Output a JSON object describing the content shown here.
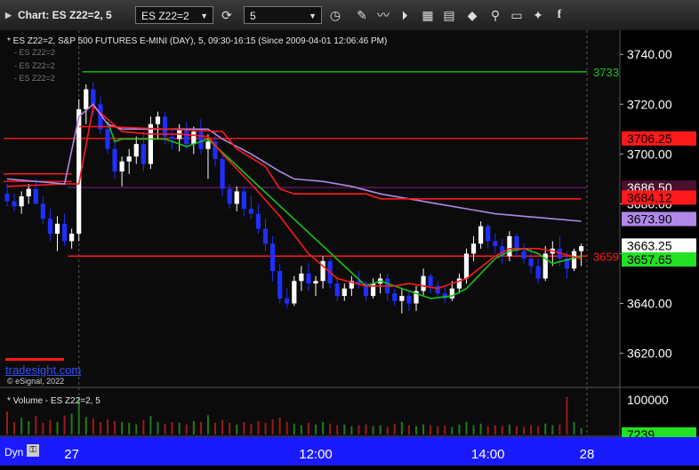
{
  "titlebar": {
    "title": "Chart: ES Z22=2, 5",
    "symbol": "ES Z22=2",
    "interval": "5"
  },
  "chart_header": "* ES Z22=2, S&P 500 FUTURES E-MINI (DAY), 5, 09:30-16:15 (Since 2009-04-01 12:06:46 PM)",
  "legend_items": [
    "- ES Z22=2",
    "- ES Z22=2",
    "- ES Z22=2"
  ],
  "watermark": "tradesight.com",
  "copyright": "© eSignal, 2022",
  "volume_header": "* Volume - ES Z22=2, 5",
  "bottom_bar": {
    "dyn_label": "Dyn"
  },
  "colors": {
    "up": "#ffffff",
    "down": "#1f2fff",
    "red": "#ff1a1a",
    "green": "#16c416",
    "purple": "#b088e8",
    "maroon": "#8b1a8b"
  },
  "chart_data": {
    "type": "candlestick",
    "price_axis": {
      "ylim": [
        3607,
        3749
      ],
      "ticks": [
        3620,
        3640,
        3660,
        3680,
        3700,
        3720,
        3740
      ]
    },
    "x_axis": {
      "tick_labels": [
        "27",
        "12:00",
        "14:00",
        "28"
      ],
      "tick_bars": [
        11,
        43,
        67,
        95
      ]
    },
    "bars": [
      [
        3684,
        3688,
        3679,
        3681
      ],
      [
        3681,
        3684,
        3677,
        3679
      ],
      [
        3679,
        3685,
        3676,
        3683
      ],
      [
        3683,
        3688,
        3680,
        3686
      ],
      [
        3686,
        3690,
        3682,
        3680
      ],
      [
        3680,
        3683,
        3672,
        3674
      ],
      [
        3674,
        3678,
        3665,
        3668
      ],
      [
        3668,
        3675,
        3661,
        3672
      ],
      [
        3672,
        3676,
        3663,
        3665
      ],
      [
        3665,
        3670,
        3662,
        3668
      ],
      [
        3668,
        3722,
        3665,
        3718
      ],
      [
        3718,
        3728,
        3712,
        3726
      ],
      [
        3726,
        3729,
        3715,
        3720
      ],
      [
        3720,
        3723,
        3708,
        3710
      ],
      [
        3710,
        3712,
        3700,
        3702
      ],
      [
        3702,
        3705,
        3690,
        3693
      ],
      [
        3693,
        3699,
        3687,
        3697
      ],
      [
        3697,
        3702,
        3692,
        3699
      ],
      [
        3699,
        3707,
        3696,
        3704
      ],
      [
        3704,
        3709,
        3693,
        3696
      ],
      [
        3696,
        3715,
        3694,
        3712
      ],
      [
        3712,
        3717,
        3706,
        3715
      ],
      [
        3715,
        3717,
        3704,
        3707
      ],
      [
        3707,
        3710,
        3702,
        3706
      ],
      [
        3706,
        3712,
        3701,
        3710
      ],
      [
        3710,
        3713,
        3702,
        3704
      ],
      [
        3704,
        3711,
        3700,
        3709
      ],
      [
        3709,
        3714,
        3700,
        3702
      ],
      [
        3702,
        3708,
        3690,
        3705
      ],
      [
        3705,
        3709,
        3695,
        3698
      ],
      [
        3698,
        3700,
        3683,
        3686
      ],
      [
        3686,
        3688,
        3678,
        3680
      ],
      [
        3680,
        3687,
        3677,
        3685
      ],
      [
        3685,
        3687,
        3675,
        3678
      ],
      [
        3678,
        3683,
        3674,
        3676
      ],
      [
        3676,
        3680,
        3668,
        3670
      ],
      [
        3670,
        3674,
        3661,
        3664
      ],
      [
        3664,
        3667,
        3649,
        3653
      ],
      [
        3653,
        3656,
        3640,
        3642
      ],
      [
        3642,
        3646,
        3638,
        3640
      ],
      [
        3640,
        3651,
        3639,
        3649
      ],
      [
        3649,
        3655,
        3645,
        3652
      ],
      [
        3652,
        3656,
        3645,
        3648
      ],
      [
        3648,
        3651,
        3643,
        3649
      ],
      [
        3649,
        3659,
        3646,
        3657
      ],
      [
        3657,
        3658,
        3646,
        3648
      ],
      [
        3648,
        3651,
        3641,
        3643
      ],
      [
        3643,
        3648,
        3641,
        3646
      ],
      [
        3646,
        3651,
        3643,
        3649
      ],
      [
        3649,
        3653,
        3646,
        3648
      ],
      [
        3648,
        3649,
        3641,
        3643
      ],
      [
        3643,
        3650,
        3642,
        3648
      ],
      [
        3648,
        3652,
        3644,
        3650
      ],
      [
        3650,
        3652,
        3641,
        3644
      ],
      [
        3644,
        3646,
        3639,
        3641
      ],
      [
        3641,
        3646,
        3636,
        3643
      ],
      [
        3643,
        3645,
        3637,
        3640
      ],
      [
        3640,
        3647,
        3637,
        3645
      ],
      [
        3645,
        3654,
        3643,
        3651
      ],
      [
        3651,
        3652,
        3644,
        3647
      ],
      [
        3647,
        3649,
        3642,
        3644
      ],
      [
        3644,
        3647,
        3640,
        3642
      ],
      [
        3642,
        3649,
        3641,
        3646
      ],
      [
        3646,
        3652,
        3644,
        3650
      ],
      [
        3650,
        3662,
        3648,
        3660
      ],
      [
        3660,
        3667,
        3657,
        3664
      ],
      [
        3664,
        3673,
        3662,
        3671
      ],
      [
        3671,
        3672,
        3662,
        3665
      ],
      [
        3665,
        3668,
        3660,
        3663
      ],
      [
        3663,
        3666,
        3656,
        3659
      ],
      [
        3659,
        3669,
        3657,
        3667
      ],
      [
        3667,
        3668,
        3659,
        3661
      ],
      [
        3661,
        3664,
        3656,
        3658
      ],
      [
        3658,
        3662,
        3652,
        3655
      ],
      [
        3655,
        3658,
        3648,
        3650
      ],
      [
        3650,
        3663,
        3649,
        3660
      ],
      [
        3660,
        3665,
        3655,
        3662
      ],
      [
        3662,
        3667,
        3655,
        3658
      ],
      [
        3658,
        3661,
        3650,
        3654
      ],
      [
        3654,
        3662,
        3653,
        3661
      ],
      [
        3661,
        3664,
        3655,
        3663
      ]
    ],
    "volume": [
      0.55,
      0.3,
      0.4,
      0.32,
      0.45,
      0.28,
      0.35,
      0.3,
      0.45,
      0.5,
      0.9,
      0.42,
      0.38,
      0.3,
      0.36,
      0.32,
      0.3,
      0.28,
      0.24,
      0.34,
      0.44,
      0.3,
      0.26,
      0.3,
      0.28,
      0.24,
      0.32,
      0.3,
      0.46,
      0.28,
      0.34,
      0.28,
      0.24,
      0.3,
      0.26,
      0.32,
      0.28,
      0.36,
      0.4,
      0.3,
      0.26,
      0.22,
      0.28,
      0.24,
      0.3,
      0.26,
      0.22,
      0.24,
      0.2,
      0.22,
      0.24,
      0.2,
      0.22,
      0.18,
      0.26,
      0.3,
      0.22,
      0.2,
      0.24,
      0.22,
      0.2,
      0.22,
      0.18,
      0.24,
      0.3,
      0.22,
      0.26,
      0.2,
      0.22,
      0.2,
      0.24,
      0.2,
      0.18,
      0.22,
      0.2,
      0.26,
      0.22,
      0.24,
      0.9,
      0.3,
      0.15
    ],
    "volume_axis": {
      "ticks": [
        "100000"
      ]
    },
    "lines": [
      {
        "color": "green",
        "points": [
          [
            14,
            3713
          ],
          [
            15,
            3705
          ],
          [
            16,
            3706
          ],
          [
            17,
            3706
          ],
          [
            18,
            3706
          ],
          [
            19,
            3706
          ],
          [
            20,
            3706
          ],
          [
            21,
            3706
          ],
          [
            22,
            3706
          ],
          [
            25,
            3703
          ],
          [
            28,
            3706
          ],
          [
            50,
            3647
          ],
          [
            52,
            3649
          ],
          [
            58,
            3643
          ],
          [
            59,
            3642
          ],
          [
            62,
            3643
          ],
          [
            64,
            3646
          ],
          [
            66,
            3652
          ],
          [
            68,
            3658
          ],
          [
            70,
            3661
          ],
          [
            72,
            3662
          ],
          [
            74,
            3660
          ],
          [
            76,
            3656
          ],
          [
            80,
            3659
          ]
        ]
      },
      {
        "color": "red",
        "points": [
          [
            0,
            3687
          ],
          [
            8,
            3688
          ],
          [
            10,
            3688
          ],
          [
            12,
            3719
          ],
          [
            14,
            3714
          ],
          [
            16,
            3709
          ],
          [
            20,
            3708
          ],
          [
            24,
            3708
          ],
          [
            28,
            3707
          ],
          [
            30,
            3700
          ],
          [
            34,
            3688
          ],
          [
            38,
            3675
          ],
          [
            42,
            3660
          ],
          [
            46,
            3650
          ],
          [
            50,
            3647
          ],
          [
            54,
            3647
          ],
          [
            56,
            3648
          ],
          [
            60,
            3646
          ],
          [
            64,
            3650
          ],
          [
            68,
            3659
          ],
          [
            70,
            3662
          ],
          [
            72,
            3662
          ],
          [
            74,
            3662
          ],
          [
            76,
            3661
          ],
          [
            80,
            3658
          ]
        ]
      },
      {
        "color": "purple",
        "points": [
          [
            0,
            3690
          ],
          [
            4,
            3689
          ],
          [
            8,
            3688
          ],
          [
            10,
            3715
          ],
          [
            12,
            3720
          ],
          [
            14,
            3712
          ],
          [
            16,
            3710
          ],
          [
            20,
            3710
          ],
          [
            24,
            3710
          ],
          [
            28,
            3710
          ],
          [
            30,
            3706
          ],
          [
            34,
            3700
          ],
          [
            38,
            3693
          ],
          [
            40,
            3690
          ],
          [
            44,
            3689
          ],
          [
            48,
            3687
          ],
          [
            52,
            3684
          ],
          [
            56,
            3682
          ],
          [
            60,
            3680
          ],
          [
            64,
            3678
          ],
          [
            68,
            3676
          ],
          [
            72,
            3675
          ],
          [
            76,
            3674
          ],
          [
            80,
            3673
          ]
        ]
      },
      {
        "color": "red",
        "points": [
          [
            10,
            3711
          ],
          [
            14,
            3711
          ],
          [
            30,
            3709
          ],
          [
            32,
            3702
          ],
          [
            36,
            3695
          ],
          [
            38,
            3686
          ],
          [
            40,
            3684
          ],
          [
            42,
            3684
          ],
          [
            50,
            3684
          ],
          [
            52,
            3682
          ],
          [
            80,
            3682
          ]
        ]
      }
    ],
    "hlines": [
      {
        "price": 3733,
        "color": "green",
        "x_from": 11,
        "label": "3733"
      },
      {
        "price": 3706.25,
        "color": "red",
        "x_from": 0
      },
      {
        "price": 3686.5,
        "color": "maroon",
        "x_from": 9
      },
      {
        "price": 3659,
        "color": "red",
        "x_from": 9,
        "label": "3659"
      },
      {
        "price": 3692,
        "color": "red",
        "x_from": 0,
        "x_to": 9
      },
      {
        "price": 3689,
        "color": "red",
        "x_from": 0,
        "x_to": 9
      }
    ],
    "price_tags": [
      {
        "price": 3706.25,
        "text": "3706.25",
        "bg": "#ff1a1a",
        "fg": "#000000"
      },
      {
        "price": 3686.5,
        "text": "3686.50",
        "bg": "#4a1030",
        "fg": "#ffffff"
      },
      {
        "price": 3682.5,
        "text": "3684.12",
        "bg": "#ff1a1a",
        "fg": "#000000"
      },
      {
        "price": 3673.9,
        "text": "3673.90",
        "bg": "#b088e8",
        "fg": "#000000"
      },
      {
        "price": 3663.25,
        "text": "3663.25",
        "bg": "#ffffff",
        "fg": "#000000"
      },
      {
        "price": 3657.65,
        "text": "3657.65",
        "bg": "#22e022",
        "fg": "#000000"
      }
    ],
    "volume_tag": {
      "text": "7239",
      "bg": "#22e022",
      "fg": "#000000"
    }
  }
}
